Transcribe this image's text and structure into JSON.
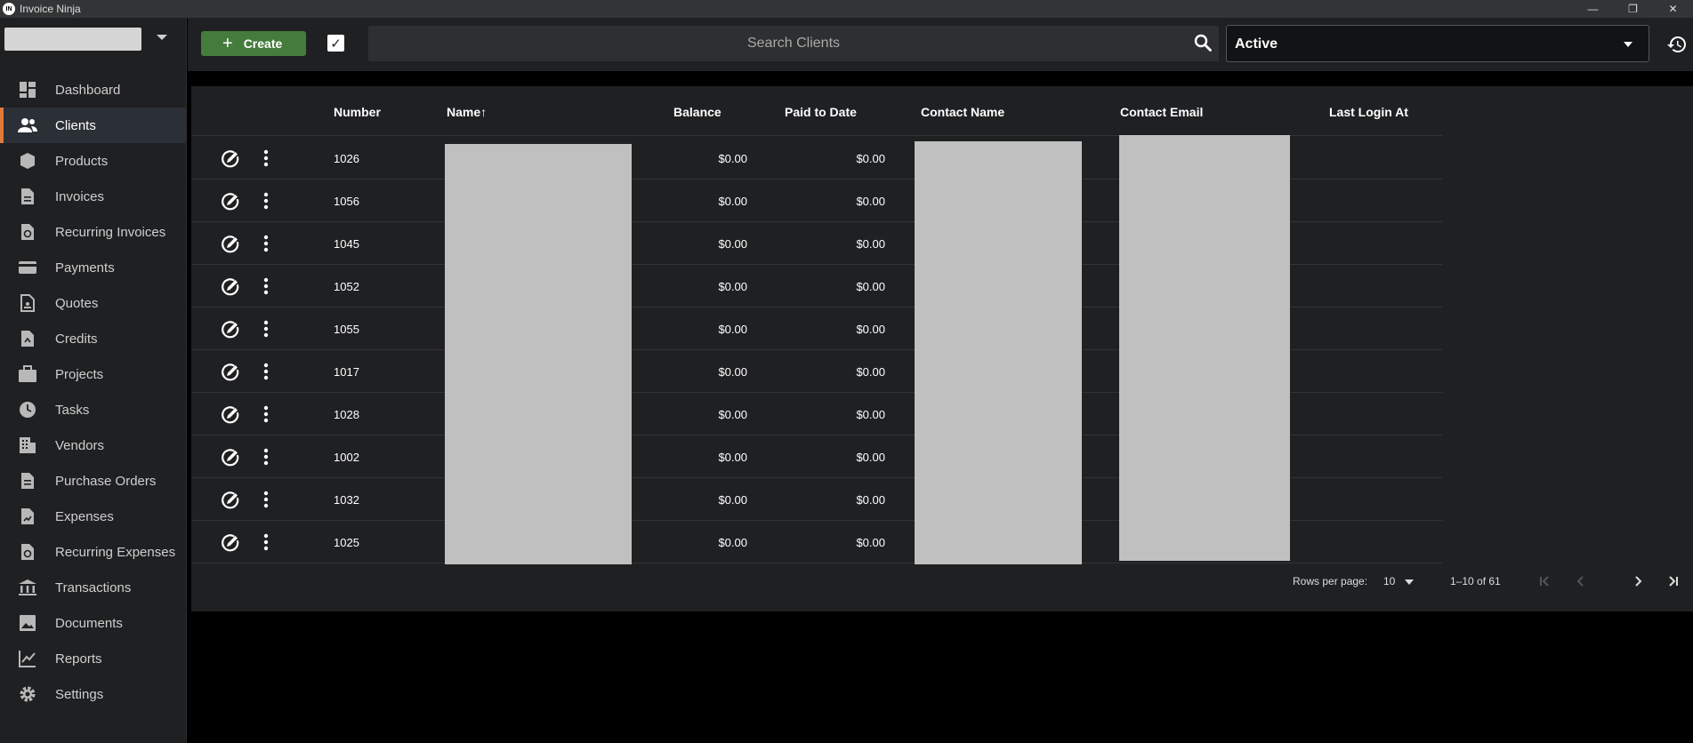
{
  "window": {
    "title": "Invoice Ninja",
    "controls": [
      "—",
      "❐",
      "✕"
    ]
  },
  "sidebar": {
    "items": [
      {
        "label": "Dashboard",
        "icon": "dashboard-icon",
        "active": false
      },
      {
        "label": "Clients",
        "icon": "clients-icon",
        "active": true
      },
      {
        "label": "Products",
        "icon": "products-icon",
        "active": false
      },
      {
        "label": "Invoices",
        "icon": "invoices-icon",
        "active": false
      },
      {
        "label": "Recurring Invoices",
        "icon": "recurring-invoices-icon",
        "active": false
      },
      {
        "label": "Payments",
        "icon": "payments-icon",
        "active": false
      },
      {
        "label": "Quotes",
        "icon": "quotes-icon",
        "active": false
      },
      {
        "label": "Credits",
        "icon": "credits-icon",
        "active": false
      },
      {
        "label": "Projects",
        "icon": "projects-icon",
        "active": false
      },
      {
        "label": "Tasks",
        "icon": "tasks-icon",
        "active": false
      },
      {
        "label": "Vendors",
        "icon": "vendors-icon",
        "active": false
      },
      {
        "label": "Purchase Orders",
        "icon": "purchase-orders-icon",
        "active": false
      },
      {
        "label": "Expenses",
        "icon": "expenses-icon",
        "active": false
      },
      {
        "label": "Recurring Expenses",
        "icon": "recurring-expenses-icon",
        "active": false
      },
      {
        "label": "Transactions",
        "icon": "transactions-icon",
        "active": false
      },
      {
        "label": "Documents",
        "icon": "documents-icon",
        "active": false
      },
      {
        "label": "Reports",
        "icon": "reports-icon",
        "active": false
      },
      {
        "label": "Settings",
        "icon": "settings-icon",
        "active": false
      }
    ]
  },
  "toolbar": {
    "create_label": "Create",
    "search_placeholder": "Search Clients",
    "status_value": "Active"
  },
  "table": {
    "headers": {
      "number": "Number",
      "name": "Name",
      "balance": "Balance",
      "paid_to_date": "Paid to Date",
      "contact_name": "Contact Name",
      "contact_email": "Contact Email",
      "last_login_at": "Last Login At"
    },
    "sort_indicator": "↑",
    "rows": [
      {
        "number": "1026",
        "balance": "$0.00",
        "paid_to_date": "$0.00"
      },
      {
        "number": "1056",
        "balance": "$0.00",
        "paid_to_date": "$0.00"
      },
      {
        "number": "1045",
        "balance": "$0.00",
        "paid_to_date": "$0.00"
      },
      {
        "number": "1052",
        "balance": "$0.00",
        "paid_to_date": "$0.00"
      },
      {
        "number": "1055",
        "balance": "$0.00",
        "paid_to_date": "$0.00"
      },
      {
        "number": "1017",
        "balance": "$0.00",
        "paid_to_date": "$0.00"
      },
      {
        "number": "1028",
        "balance": "$0.00",
        "paid_to_date": "$0.00"
      },
      {
        "number": "1002",
        "balance": "$0.00",
        "paid_to_date": "$0.00"
      },
      {
        "number": "1032",
        "balance": "$0.00",
        "paid_to_date": "$0.00"
      },
      {
        "number": "1025",
        "balance": "$0.00",
        "paid_to_date": "$0.00"
      }
    ]
  },
  "pagination": {
    "rows_per_page_label": "Rows per page:",
    "rows_per_page": "10",
    "range": "1–10 of 61"
  },
  "colors": {
    "accent": "#e07b39",
    "create_button": "#447d3b",
    "background": "#1f2022"
  }
}
